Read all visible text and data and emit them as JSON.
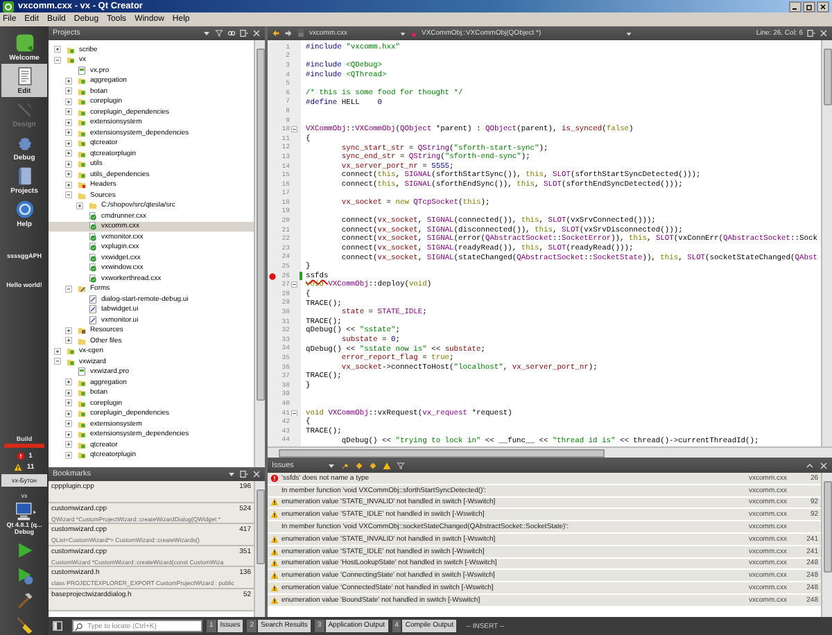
{
  "window": {
    "title": "vxcomm.cxx - vx - Qt Creator"
  },
  "menu": [
    "File",
    "Edit",
    "Build",
    "Debug",
    "Tools",
    "Window",
    "Help"
  ],
  "modes": [
    {
      "label": "Welcome",
      "kind": "welcome",
      "selected": false,
      "disabled": false
    },
    {
      "label": "Edit",
      "kind": "edit",
      "selected": true,
      "disabled": false
    },
    {
      "label": "Design",
      "kind": "design",
      "selected": false,
      "disabled": true
    },
    {
      "label": "Debug",
      "kind": "debug",
      "selected": false,
      "disabled": false
    },
    {
      "label": "Projects",
      "kind": "projects",
      "selected": false,
      "disabled": false
    },
    {
      "label": "Help",
      "kind": "help",
      "selected": false,
      "disabled": false
    }
  ],
  "sidebar_notes": [
    "ssssggAPH",
    "Hello world!"
  ],
  "build_status": {
    "label": "Build",
    "failed": true,
    "level": 1,
    "errors": "1",
    "warnings": "11"
  },
  "target": {
    "button": "vx-Бутон",
    "project": "vx",
    "kit": "Qt 4.8.1 (q...",
    "build_config": "Debug"
  },
  "projects_panel": {
    "title": "Projects",
    "tree": [
      {
        "name": "scribe",
        "kind": "project",
        "expanded": false,
        "selected": false
      },
      {
        "name": "vx",
        "kind": "project",
        "expanded": true,
        "selected": false,
        "children": [
          {
            "name": "vx.pro",
            "kind": "pro",
            "selected": false
          },
          {
            "name": "aggregation",
            "kind": "project",
            "expanded": false,
            "selected": false
          },
          {
            "name": "botan",
            "kind": "project",
            "expanded": false,
            "selected": false
          },
          {
            "name": "coreplugin",
            "kind": "project",
            "expanded": false,
            "selected": false
          },
          {
            "name": "coreplugin_dependencies",
            "kind": "project",
            "expanded": false,
            "selected": false
          },
          {
            "name": "extensionsystem",
            "kind": "project",
            "expanded": false,
            "selected": false
          },
          {
            "name": "extensionsystem_dependencies",
            "kind": "project",
            "expanded": false,
            "selected": false
          },
          {
            "name": "qtcreator",
            "kind": "project",
            "expanded": false,
            "selected": false
          },
          {
            "name": "qtcreatorplugin",
            "kind": "project",
            "expanded": false,
            "selected": false
          },
          {
            "name": "utils",
            "kind": "project",
            "expanded": false,
            "selected": false
          },
          {
            "name": "utils_dependencies",
            "kind": "project",
            "expanded": false,
            "selected": false
          },
          {
            "name": "Headers",
            "kind": "headers",
            "expanded": false,
            "selected": false
          },
          {
            "name": "Sources",
            "kind": "sources",
            "expanded": true,
            "selected": false,
            "children": [
              {
                "name": "C:/shopov/src/qtesla/src",
                "kind": "folder",
                "expanded": false,
                "selected": false
              },
              {
                "name": "cmdrunner.cxx",
                "kind": "source",
                "selected": false
              },
              {
                "name": "vxcomm.cxx",
                "kind": "source",
                "selected": true
              },
              {
                "name": "vxmonitor.cxx",
                "kind": "source",
                "selected": false
              },
              {
                "name": "vxplugin.cxx",
                "kind": "source",
                "selected": false
              },
              {
                "name": "vxwidget.cxx",
                "kind": "source",
                "selected": false
              },
              {
                "name": "vxwindow.cxx",
                "kind": "source",
                "selected": false
              },
              {
                "name": "vxworkerthread.cxx",
                "kind": "source",
                "selected": false
              }
            ]
          },
          {
            "name": "Forms",
            "kind": "forms",
            "expanded": true,
            "selected": false,
            "children": [
              {
                "name": "dialog-start-remote-debug.ui",
                "kind": "form",
                "selected": false
              },
              {
                "name": "tabwidget.ui",
                "kind": "form",
                "selected": false
              },
              {
                "name": "vxmonitor.ui",
                "kind": "form",
                "selected": false
              }
            ]
          },
          {
            "name": "Resources",
            "kind": "resources",
            "expanded": false,
            "selected": false
          },
          {
            "name": "Other files",
            "kind": "folder",
            "expanded": false,
            "selected": false
          }
        ]
      },
      {
        "name": "vx-cgen",
        "kind": "project",
        "expanded": false,
        "selected": false
      },
      {
        "name": "vxwizard",
        "kind": "project",
        "expanded": true,
        "selected": false,
        "children": [
          {
            "name": "vxwizard.pro",
            "kind": "pro",
            "selected": false
          },
          {
            "name": "aggregation",
            "kind": "project",
            "expanded": false,
            "selected": false
          },
          {
            "name": "botan",
            "kind": "project",
            "expanded": false,
            "selected": false
          },
          {
            "name": "coreplugin",
            "kind": "project",
            "expanded": false,
            "selected": false
          },
          {
            "name": "coreplugin_dependencies",
            "kind": "project",
            "expanded": false,
            "selected": false
          },
          {
            "name": "extensionsystem",
            "kind": "project",
            "expanded": false,
            "selected": false
          },
          {
            "name": "extensionsystem_dependencies",
            "kind": "project",
            "expanded": false,
            "selected": false
          },
          {
            "name": "qtcreator",
            "kind": "project",
            "expanded": false,
            "selected": false
          },
          {
            "name": "qtcreatorplugin",
            "kind": "project",
            "expanded": false,
            "selected": false
          }
        ]
      }
    ]
  },
  "bookmarks_panel": {
    "title": "Bookmarks",
    "items": [
      {
        "file": "cppplugin.cpp",
        "line": "196"
      },
      {
        "file": "customwizard.cpp",
        "line": "524",
        "text": "QWizard *CustomProjectWizard::createWizardDialog(QWidget *"
      },
      {
        "file": "customwizard.cpp",
        "line": "417",
        "text": "QList<CustomWizard*> CustomWizard::createWizards()"
      },
      {
        "file": "customwizard.cpp",
        "line": "351",
        "text": "CustomWizard *CustomWizard::createWizard(const CustomWiza"
      },
      {
        "file": "customwizard.h",
        "line": "136",
        "text": "class PROJECTEXPLORER_EXPORT CustomProjectWizard : public"
      },
      {
        "file": "baseprojectwizarddialog.h",
        "line": "52"
      }
    ]
  },
  "editor": {
    "file": "vxcomm.cxx",
    "symbol": "VXCommObj::VXCommObj(QObject *)",
    "position": "Line: 26, Col: 6",
    "lines": [
      {
        "n": "1",
        "parts": [
          {
            "kind": "preprocessor",
            "text": "#include "
          },
          {
            "kind": "string",
            "text": "\"vxcomm.hxx\""
          }
        ]
      },
      {
        "n": "2"
      },
      {
        "n": "3",
        "parts": [
          {
            "kind": "preprocessor",
            "text": "#include "
          },
          {
            "kind": "string",
            "text": "<QDebug>"
          }
        ]
      },
      {
        "n": "4",
        "parts": [
          {
            "kind": "preprocessor",
            "text": "#include "
          },
          {
            "kind": "string",
            "text": "<QThread>"
          }
        ]
      },
      {
        "n": "5"
      },
      {
        "n": "6",
        "parts": [
          {
            "kind": "comment",
            "text": "/* this is some food for thought */"
          }
        ]
      },
      {
        "n": "7",
        "parts": [
          {
            "kind": "preprocessor",
            "text": "#define "
          },
          {
            "kind": "plain",
            "text": "HELL    "
          },
          {
            "kind": "number",
            "text": "0"
          }
        ]
      },
      {
        "n": "8"
      },
      {
        "n": "9"
      },
      {
        "n": "10",
        "foldable": true,
        "parts": [
          {
            "kind": "type",
            "text": "VXCommObj"
          },
          {
            "kind": "plain",
            "text": "::"
          },
          {
            "kind": "type",
            "text": "VXCommObj"
          },
          {
            "kind": "plain",
            "text": "("
          },
          {
            "kind": "type",
            "text": "QObject"
          },
          {
            "kind": "plain",
            "text": " *parent) : "
          },
          {
            "kind": "type",
            "text": "QObject"
          },
          {
            "kind": "plain",
            "text": "(parent), "
          },
          {
            "kind": "field",
            "text": "is_synced"
          },
          {
            "kind": "plain",
            "text": "("
          },
          {
            "kind": "keyword",
            "text": "false"
          },
          {
            "kind": "plain",
            "text": ")"
          }
        ]
      },
      {
        "n": "11",
        "parts": [
          {
            "kind": "plain",
            "text": "{"
          }
        ]
      },
      {
        "n": "12",
        "parts": [
          {
            "kind": "field",
            "text": "        sync_start_str"
          },
          {
            "kind": "plain",
            "text": " = "
          },
          {
            "kind": "type",
            "text": "QString"
          },
          {
            "kind": "plain",
            "text": "("
          },
          {
            "kind": "string",
            "text": "\"sforth-start-sync\""
          },
          {
            "kind": "plain",
            "text": ");"
          }
        ]
      },
      {
        "n": "13",
        "parts": [
          {
            "kind": "field",
            "text": "        sync_end_str"
          },
          {
            "kind": "plain",
            "text": " = "
          },
          {
            "kind": "type",
            "text": "QString"
          },
          {
            "kind": "plain",
            "text": "("
          },
          {
            "kind": "string",
            "text": "\"sforth-end-sync\""
          },
          {
            "kind": "plain",
            "text": ");"
          }
        ]
      },
      {
        "n": "14",
        "parts": [
          {
            "kind": "field",
            "text": "        vx_server_port_nr"
          },
          {
            "kind": "plain",
            "text": " = "
          },
          {
            "kind": "number",
            "text": "5555"
          },
          {
            "kind": "plain",
            "text": ";"
          }
        ]
      },
      {
        "n": "15",
        "parts": [
          {
            "kind": "plain",
            "text": "        connect("
          },
          {
            "kind": "keyword",
            "text": "this"
          },
          {
            "kind": "plain",
            "text": ", "
          },
          {
            "kind": "macro",
            "text": "SIGNAL"
          },
          {
            "kind": "plain",
            "text": "(sforthStartSync()), "
          },
          {
            "kind": "keyword",
            "text": "this"
          },
          {
            "kind": "plain",
            "text": ", "
          },
          {
            "kind": "macro",
            "text": "SLOT"
          },
          {
            "kind": "plain",
            "text": "(sforthStartSyncDetected()));"
          }
        ]
      },
      {
        "n": "16",
        "parts": [
          {
            "kind": "plain",
            "text": "        connect("
          },
          {
            "kind": "keyword",
            "text": "this"
          },
          {
            "kind": "plain",
            "text": ", "
          },
          {
            "kind": "macro",
            "text": "SIGNAL"
          },
          {
            "kind": "plain",
            "text": "(sforthEndSync()), "
          },
          {
            "kind": "keyword",
            "text": "this"
          },
          {
            "kind": "plain",
            "text": ", "
          },
          {
            "kind": "macro",
            "text": "SLOT"
          },
          {
            "kind": "plain",
            "text": "(sforthEndSyncDetected()));"
          }
        ]
      },
      {
        "n": "17"
      },
      {
        "n": "18",
        "parts": [
          {
            "kind": "field",
            "text": "        vx_socket"
          },
          {
            "kind": "plain",
            "text": " = "
          },
          {
            "kind": "keyword",
            "text": "new "
          },
          {
            "kind": "type",
            "text": "QTcpSocket"
          },
          {
            "kind": "plain",
            "text": "("
          },
          {
            "kind": "keyword",
            "text": "this"
          },
          {
            "kind": "plain",
            "text": ");"
          }
        ]
      },
      {
        "n": "19"
      },
      {
        "n": "20",
        "parts": [
          {
            "kind": "plain",
            "text": "        connect("
          },
          {
            "kind": "field",
            "text": "vx_socket"
          },
          {
            "kind": "plain",
            "text": ", "
          },
          {
            "kind": "macro",
            "text": "SIGNAL"
          },
          {
            "kind": "plain",
            "text": "(connected()), "
          },
          {
            "kind": "keyword",
            "text": "this"
          },
          {
            "kind": "plain",
            "text": ", "
          },
          {
            "kind": "macro",
            "text": "SLOT"
          },
          {
            "kind": "plain",
            "text": "(vxSrvConnected()));"
          }
        ]
      },
      {
        "n": "21",
        "parts": [
          {
            "kind": "plain",
            "text": "        connect("
          },
          {
            "kind": "field",
            "text": "vx_socket"
          },
          {
            "kind": "plain",
            "text": ", "
          },
          {
            "kind": "macro",
            "text": "SIGNAL"
          },
          {
            "kind": "plain",
            "text": "(disconnected()), "
          },
          {
            "kind": "keyword",
            "text": "this"
          },
          {
            "kind": "plain",
            "text": ", "
          },
          {
            "kind": "macro",
            "text": "SLOT"
          },
          {
            "kind": "plain",
            "text": "(vxSrvDisconnected()));"
          }
        ]
      },
      {
        "n": "22",
        "parts": [
          {
            "kind": "plain",
            "text": "        connect("
          },
          {
            "kind": "field",
            "text": "vx_socket"
          },
          {
            "kind": "plain",
            "text": ", "
          },
          {
            "kind": "macro",
            "text": "SIGNAL"
          },
          {
            "kind": "plain",
            "text": "(error("
          },
          {
            "kind": "type",
            "text": "QAbstractSocket"
          },
          {
            "kind": "plain",
            "text": "::"
          },
          {
            "kind": "type",
            "text": "SocketError"
          },
          {
            "kind": "plain",
            "text": ")), "
          },
          {
            "kind": "keyword",
            "text": "this"
          },
          {
            "kind": "plain",
            "text": ", "
          },
          {
            "kind": "macro",
            "text": "SLOT"
          },
          {
            "kind": "plain",
            "text": "(vxConnErr("
          },
          {
            "kind": "type",
            "text": "QAbstractSocket"
          },
          {
            "kind": "plain",
            "text": "::Sock"
          }
        ]
      },
      {
        "n": "23",
        "parts": [
          {
            "kind": "plain",
            "text": "        connect("
          },
          {
            "kind": "field",
            "text": "vx_socket"
          },
          {
            "kind": "plain",
            "text": ", "
          },
          {
            "kind": "macro",
            "text": "SIGNAL"
          },
          {
            "kind": "plain",
            "text": "(readyRead()), "
          },
          {
            "kind": "keyword",
            "text": "this"
          },
          {
            "kind": "plain",
            "text": ", "
          },
          {
            "kind": "macro",
            "text": "SLOT"
          },
          {
            "kind": "plain",
            "text": "(readyRead()));"
          }
        ]
      },
      {
        "n": "24",
        "parts": [
          {
            "kind": "plain",
            "text": "        connect("
          },
          {
            "kind": "field",
            "text": "vx_socket"
          },
          {
            "kind": "plain",
            "text": ", "
          },
          {
            "kind": "macro",
            "text": "SIGNAL"
          },
          {
            "kind": "plain",
            "text": "(stateChanged("
          },
          {
            "kind": "type",
            "text": "QAbstractSocket"
          },
          {
            "kind": "plain",
            "text": "::"
          },
          {
            "kind": "type",
            "text": "SocketState"
          },
          {
            "kind": "plain",
            "text": ")), "
          },
          {
            "kind": "keyword",
            "text": "this"
          },
          {
            "kind": "plain",
            "text": ", "
          },
          {
            "kind": "macro",
            "text": "SLOT"
          },
          {
            "kind": "plain",
            "text": "(socketStateChanged("
          },
          {
            "kind": "type",
            "text": "QAbst"
          }
        ]
      },
      {
        "n": "25",
        "parts": [
          {
            "kind": "plain",
            "text": "}"
          }
        ]
      },
      {
        "n": "26",
        "error": true,
        "modified": true,
        "parts": [
          {
            "kind": "error",
            "text": "ssfds"
          }
        ]
      },
      {
        "n": "27",
        "foldable": true,
        "parts": [
          {
            "kind": "keyword",
            "text": "void "
          },
          {
            "kind": "type",
            "text": "VXCommObj"
          },
          {
            "kind": "plain",
            "text": "::deploy("
          },
          {
            "kind": "keyword",
            "text": "void"
          },
          {
            "kind": "plain",
            "text": ")"
          }
        ]
      },
      {
        "n": "28",
        "parts": [
          {
            "kind": "plain",
            "text": "{"
          }
        ]
      },
      {
        "n": "29",
        "parts": [
          {
            "kind": "plain",
            "text": "TRACE();"
          }
        ]
      },
      {
        "n": "30",
        "parts": [
          {
            "kind": "field",
            "text": "        state"
          },
          {
            "kind": "plain",
            "text": " = "
          },
          {
            "kind": "type",
            "text": "STATE_IDLE"
          },
          {
            "kind": "plain",
            "text": ";"
          }
        ]
      },
      {
        "n": "31",
        "parts": [
          {
            "kind": "plain",
            "text": "TRACE();"
          }
        ]
      },
      {
        "n": "32",
        "parts": [
          {
            "kind": "plain",
            "text": "qDebug() << "
          },
          {
            "kind": "string",
            "text": "\"sstate\""
          },
          {
            "kind": "plain",
            "text": ";"
          }
        ]
      },
      {
        "n": "33",
        "parts": [
          {
            "kind": "field",
            "text": "        substate"
          },
          {
            "kind": "plain",
            "text": " = "
          },
          {
            "kind": "number",
            "text": "0"
          },
          {
            "kind": "plain",
            "text": ";"
          }
        ]
      },
      {
        "n": "34",
        "parts": [
          {
            "kind": "plain",
            "text": "qDebug() << "
          },
          {
            "kind": "string",
            "text": "\"sstate now is\""
          },
          {
            "kind": "plain",
            "text": " << "
          },
          {
            "kind": "field",
            "text": "substate"
          },
          {
            "kind": "plain",
            "text": ";"
          }
        ]
      },
      {
        "n": "35",
        "parts": [
          {
            "kind": "field",
            "text": "        error_report_flag"
          },
          {
            "kind": "plain",
            "text": " = "
          },
          {
            "kind": "keyword",
            "text": "true"
          },
          {
            "kind": "plain",
            "text": ";"
          }
        ]
      },
      {
        "n": "36",
        "parts": [
          {
            "kind": "field",
            "text": "        vx_socket"
          },
          {
            "kind": "plain",
            "text": "->connectToHost("
          },
          {
            "kind": "string",
            "text": "\"localhost\""
          },
          {
            "kind": "plain",
            "text": ", "
          },
          {
            "kind": "field",
            "text": "vx_server_port_nr"
          },
          {
            "kind": "plain",
            "text": ");"
          }
        ]
      },
      {
        "n": "37",
        "parts": [
          {
            "kind": "plain",
            "text": "TRACE();"
          }
        ]
      },
      {
        "n": "38",
        "parts": [
          {
            "kind": "plain",
            "text": "}"
          }
        ]
      },
      {
        "n": "39"
      },
      {
        "n": "40"
      },
      {
        "n": "41",
        "foldable": true,
        "parts": [
          {
            "kind": "keyword",
            "text": "void "
          },
          {
            "kind": "type",
            "text": "VXCommObj"
          },
          {
            "kind": "plain",
            "text": "::vxRequest("
          },
          {
            "kind": "type",
            "text": "vx_request"
          },
          {
            "kind": "plain",
            "text": " *request)"
          }
        ]
      },
      {
        "n": "42",
        "parts": [
          {
            "kind": "plain",
            "text": "{"
          }
        ]
      },
      {
        "n": "43",
        "parts": [
          {
            "kind": "plain",
            "text": "TRACE();"
          }
        ]
      },
      {
        "n": "44",
        "parts": [
          {
            "kind": "plain",
            "text": "        qDebug() << "
          },
          {
            "kind": "string",
            "text": "\"trying to lock in\""
          },
          {
            "kind": "plain",
            "text": " << __func__ << "
          },
          {
            "kind": "string",
            "text": "\"thread id is\""
          },
          {
            "kind": "plain",
            "text": " << thread()->currentThreadId();"
          }
        ]
      }
    ]
  },
  "issues_panel": {
    "title": "Issues",
    "items": [
      {
        "kind": "error",
        "text": "'ssfds' does not name a type",
        "file": "vxcomm.cxx",
        "line": "26"
      },
      {
        "kind": "context",
        "text": "In member function 'void VXCommObj::sforthStartSyncDetected()':",
        "file": "vxcomm.cxx"
      },
      {
        "kind": "warning",
        "text": "enumeration value 'STATE_INVALID' not handled in switch [-Wswitch]",
        "file": "vxcomm.cxx",
        "line": "92"
      },
      {
        "kind": "warning",
        "text": "enumeration value 'STATE_IDLE' not handled in switch [-Wswitch]",
        "file": "vxcomm.cxx",
        "line": "92"
      },
      {
        "kind": "context",
        "text": "In member function 'void VXCommObj::socketStateChanged(QAbstractSocket::SocketState)':",
        "file": "vxcomm.cxx"
      },
      {
        "kind": "warning",
        "text": "enumeration value 'STATE_INVALID' not handled in switch [-Wswitch]",
        "file": "vxcomm.cxx",
        "line": "241"
      },
      {
        "kind": "warning",
        "text": "enumeration value 'STATE_IDLE' not handled in switch [-Wswitch]",
        "file": "vxcomm.cxx",
        "line": "241"
      },
      {
        "kind": "warning",
        "text": "enumeration value 'HostLookupState' not handled in switch [-Wswitch]",
        "file": "vxcomm.cxx",
        "line": "248"
      },
      {
        "kind": "warning",
        "text": "enumeration value 'ConnectingState' not handled in switch [-Wswitch]",
        "file": "vxcomm.cxx",
        "line": "248"
      },
      {
        "kind": "warning",
        "text": "enumeration value 'ConnectedState' not handled in switch [-Wswitch]",
        "file": "vxcomm.cxx",
        "line": "248"
      },
      {
        "kind": "warning",
        "text": "enumeration value 'BoundState' not handled in switch [-Wswitch]",
        "file": "vxcomm.cxx",
        "line": "248"
      }
    ]
  },
  "locator": {
    "placeholder": "Type to locate (Ctrl+K)"
  },
  "output_tabs": [
    {
      "number": "1",
      "label": "Issues"
    },
    {
      "number": "2",
      "label": "Search Results"
    },
    {
      "number": "3",
      "label": "Application Output"
    },
    {
      "number": "4",
      "label": "Compile Output"
    }
  ],
  "mode_indicator": "-- INSERT --"
}
